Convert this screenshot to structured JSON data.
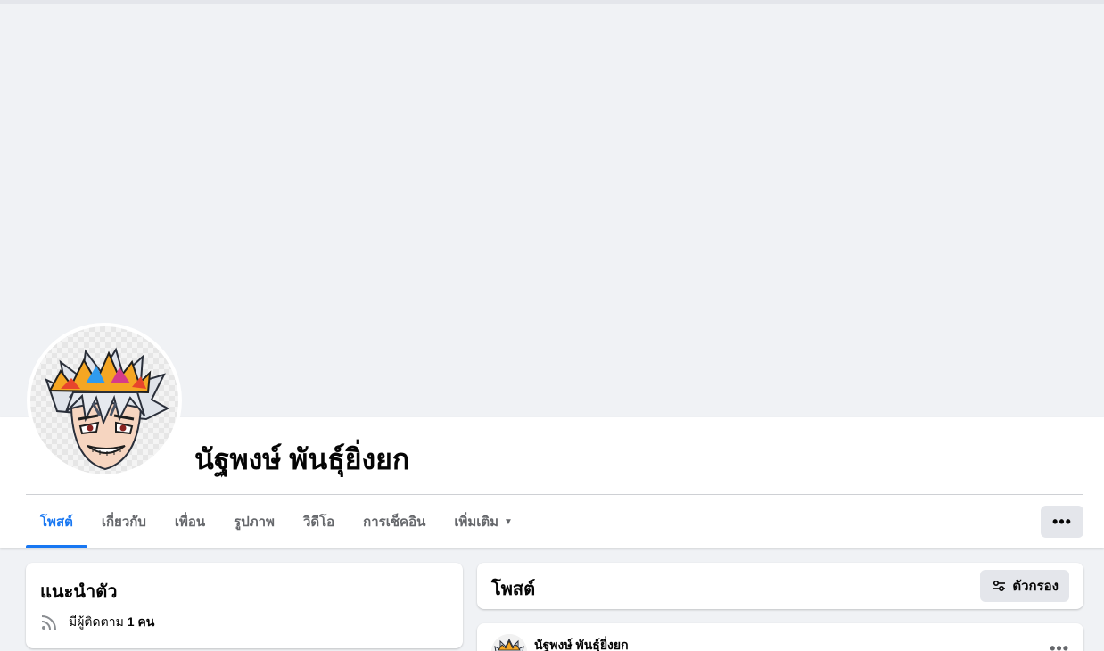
{
  "profile": {
    "name": "นัฐพงษ์ พันธุ์ยิ่งยก"
  },
  "tabs": [
    {
      "label": "โพสต์",
      "active": true
    },
    {
      "label": "เกี่ยวกับ"
    },
    {
      "label": "เพื่อน"
    },
    {
      "label": "รูปภาพ"
    },
    {
      "label": "วิดีโอ"
    },
    {
      "label": "การเช็คอิน"
    },
    {
      "label": "เพิ่มเติม",
      "icon": "caret-down-icon"
    }
  ],
  "more_button": {
    "label": "•••"
  },
  "intro": {
    "title": "แนะนำตัว",
    "followers_prefix": "มีผู้ติดตาม",
    "followers_count": "1 คน",
    "icon": "rss-icon"
  },
  "posts": {
    "title": "โพสต์",
    "filter_label": "ตัวกรอง",
    "filter_icon": "sliders-icon"
  },
  "post": {
    "author": "นัฐพงษ์ พันธุ์ยิ่งยก",
    "menu_label": "•••"
  },
  "colors": {
    "accent": "#1877f2",
    "page_bg": "#f0f2f5",
    "button_bg": "#e4e6eb",
    "secondary_text": "#65676b"
  }
}
